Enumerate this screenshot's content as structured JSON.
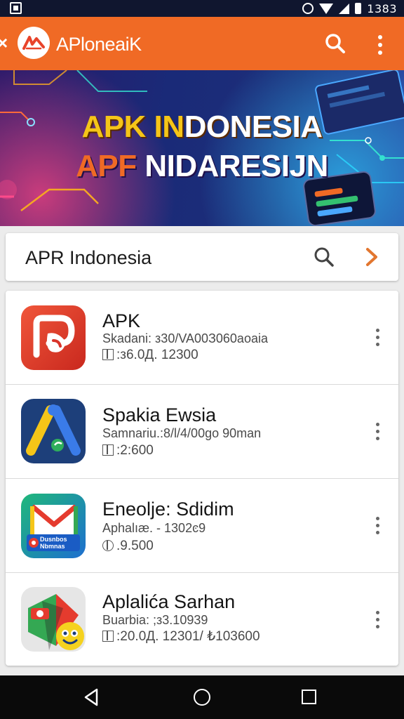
{
  "status_bar": {
    "time": "1383",
    "icons": [
      "notification-icon",
      "alarm-icon",
      "wifi-icon",
      "signal-icon",
      "battery-icon"
    ]
  },
  "app_bar": {
    "title": "APloneaiK",
    "icons": [
      "close-icon",
      "logo-icon",
      "search-icon",
      "more-vert-icon"
    ],
    "color": "#f06a25"
  },
  "banner": {
    "line1_part1": "APK IN",
    "line1_part2": "DONESIA",
    "line2_part1": "APF ",
    "line2_part2": "NIDARESIJN"
  },
  "search_card": {
    "label": "APR Indonesia",
    "icons": [
      "search-icon",
      "chevron-right-icon"
    ]
  },
  "apps": [
    {
      "title": "APK",
      "subtitle": "Skadani: з30/VA00З060aoaia",
      "meta": ":з6.0Д. 12300",
      "meta_icon": "calendar-icon"
    },
    {
      "title": "Spakia Ewsia",
      "subtitle": "Samnariu.:8/l/4/00go 90man",
      "meta": ":2:600",
      "meta_icon": "calendar-icon"
    },
    {
      "title": "Eneolje: Sdidim",
      "subtitle": "Aphalıæ. - 1302ͼ9",
      "meta": ".9.500",
      "meta_icon": "clock-icon",
      "icon_label": "Dusnbos\nNbmnas"
    },
    {
      "title": "Aplalića Sarhan",
      "subtitle": "Buarbia: ;з3.10939",
      "meta": ":20.0Д. 12301/ ₺103600",
      "meta_icon": "calendar-icon"
    }
  ],
  "nav_bar": {
    "icons": [
      "back-icon",
      "home-icon",
      "recents-icon"
    ]
  }
}
